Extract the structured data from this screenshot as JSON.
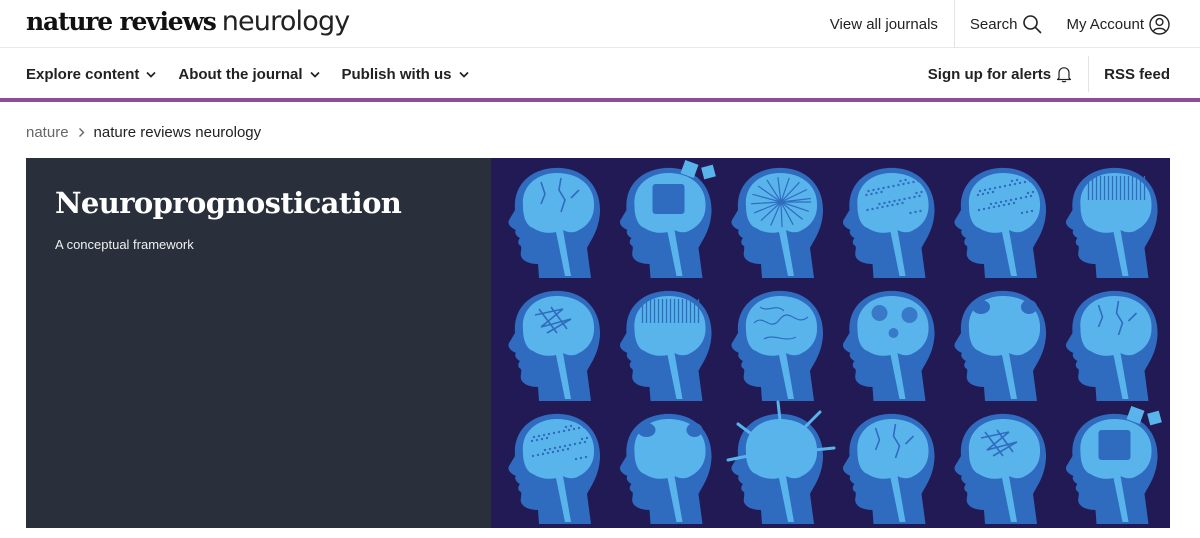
{
  "header": {
    "brand_bold": "nature reviews",
    "brand_light": "neurology",
    "links": {
      "view_all_journals": "View all journals",
      "search": "Search",
      "my_account": "My Account"
    },
    "icons": {
      "search": "search-icon",
      "account": "user-circle-icon"
    }
  },
  "nav": {
    "items": [
      {
        "label": "Explore content",
        "icon": "chevron-down-icon"
      },
      {
        "label": "About the journal",
        "icon": "chevron-down-icon"
      },
      {
        "label": "Publish with us",
        "icon": "chevron-down-icon"
      }
    ],
    "alerts": {
      "label": "Sign up for alerts",
      "icon": "bell-icon"
    },
    "rss": {
      "label": "RSS feed"
    }
  },
  "colors": {
    "accent": "#8e4b97",
    "hero_panel": "#29303b",
    "image_background": "#211a55",
    "head": "#2f6cbf",
    "brain": "#5ab4ec"
  },
  "breadcrumb": {
    "root": "nature",
    "separator_icon": "chevron-right-icon",
    "current": "nature reviews neurology"
  },
  "hero": {
    "title": "Neuroprognostication",
    "subtitle": "A conceptual framework",
    "image": {
      "description": "Grid of head silhouettes with varied brain illustrations",
      "rows": 3,
      "columns": 6,
      "variants": [
        [
          "cracked",
          "puzzle",
          "radial",
          "dotted-noise",
          "speckled",
          "striped"
        ],
        [
          "scribble",
          "striped",
          "veins",
          "lesions",
          "eroded",
          "cracked-edge"
        ],
        [
          "speckled",
          "eroded",
          "spiked",
          "cracked",
          "scribble",
          "puzzle"
        ]
      ]
    }
  }
}
